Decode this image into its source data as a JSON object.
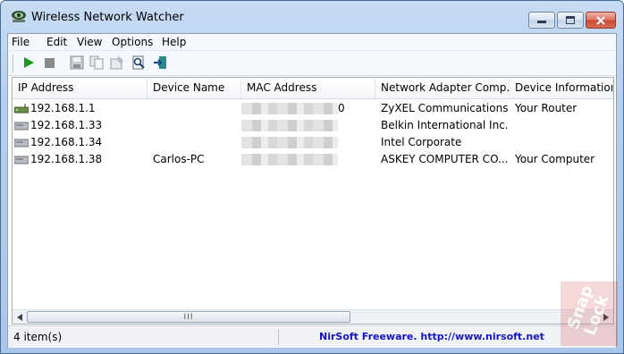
{
  "window": {
    "title": "Wireless Network Watcher",
    "minimize_icon": "minimize-icon",
    "maximize_icon": "maximize-icon",
    "close_icon": "close-icon",
    "close_color": "#c94a33"
  },
  "menu": [
    "File",
    "Edit",
    "View",
    "Options",
    "Help"
  ],
  "toolbar": {
    "icons": [
      "play-icon",
      "stop-icon",
      "save-icon",
      "copy-icon",
      "properties-icon",
      "find-icon",
      "exit-icon"
    ]
  },
  "table": {
    "columns": [
      "IP Address",
      "Device Name",
      "MAC Address",
      "Network Adapter Comp...",
      "Device Information"
    ],
    "rows": [
      {
        "ip": "192.168.1.1",
        "name": "",
        "mac_tail": "0",
        "adapter": "ZyXEL Communications...",
        "info": "Your Router",
        "icon": "router-icon"
      },
      {
        "ip": "192.168.1.33",
        "name": "",
        "mac_tail": "",
        "adapter": "Belkin International Inc.",
        "info": "",
        "icon": "computer-icon"
      },
      {
        "ip": "192.168.1.34",
        "name": "",
        "mac_tail": "",
        "adapter": "Intel Corporate",
        "info": "",
        "icon": "computer-icon"
      },
      {
        "ip": "192.168.1.38",
        "name": "Carlos-PC",
        "mac_tail": "",
        "adapter": "ASKEY COMPUTER CO...",
        "info": "Your Computer",
        "icon": "computer-icon"
      }
    ]
  },
  "scrollbar": {
    "grip": "III"
  },
  "status": {
    "count": "4 item(s)",
    "credit": "NirSoft Freeware.  http://www.nirsoft.net",
    "credit_color": "#1414c8"
  },
  "watermark": {
    "text": "SnapLock"
  }
}
